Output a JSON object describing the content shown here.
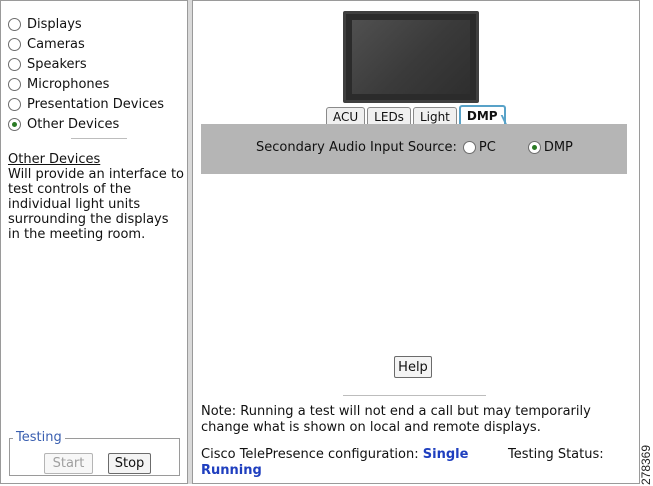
{
  "left_panel": {
    "options": [
      {
        "label": "Displays",
        "selected": false
      },
      {
        "label": "Cameras",
        "selected": false
      },
      {
        "label": "Speakers",
        "selected": false
      },
      {
        "label": "Microphones",
        "selected": false
      },
      {
        "label": "Presentation Devices",
        "selected": false
      },
      {
        "label": "Other Devices",
        "selected": true
      }
    ],
    "description_title": "Other Devices",
    "description_text": "Will provide an interface to test controls of the individual light units surrounding the displays in the meeting room.",
    "testing_legend": "Testing",
    "start_label": "Start",
    "stop_label": "Stop"
  },
  "tabs": [
    {
      "label": "ACU",
      "active": false
    },
    {
      "label": "LEDs",
      "active": false
    },
    {
      "label": "Light",
      "active": false
    },
    {
      "label": "DMP",
      "active": true
    }
  ],
  "dmp_panel": {
    "label": "Secondary Audio Input Source:",
    "option_pc": "PC",
    "option_dmp": "DMP",
    "selected": "DMP"
  },
  "help_label": "Help",
  "note_text": "Note: Running a test will not end a call but may temporarily change what is shown on local and remote displays.",
  "config": {
    "label": "Cisco TelePresence configuration:",
    "value": "Single",
    "status_label": "Testing Status:",
    "status_value": "Running"
  },
  "figure_number": "278369",
  "colors": {
    "accent_link": "#1f3fbf",
    "tab_active_border": "#58a2c8",
    "panel_gray": "#b5b5b5",
    "legend_blue": "#3a5fb0"
  }
}
